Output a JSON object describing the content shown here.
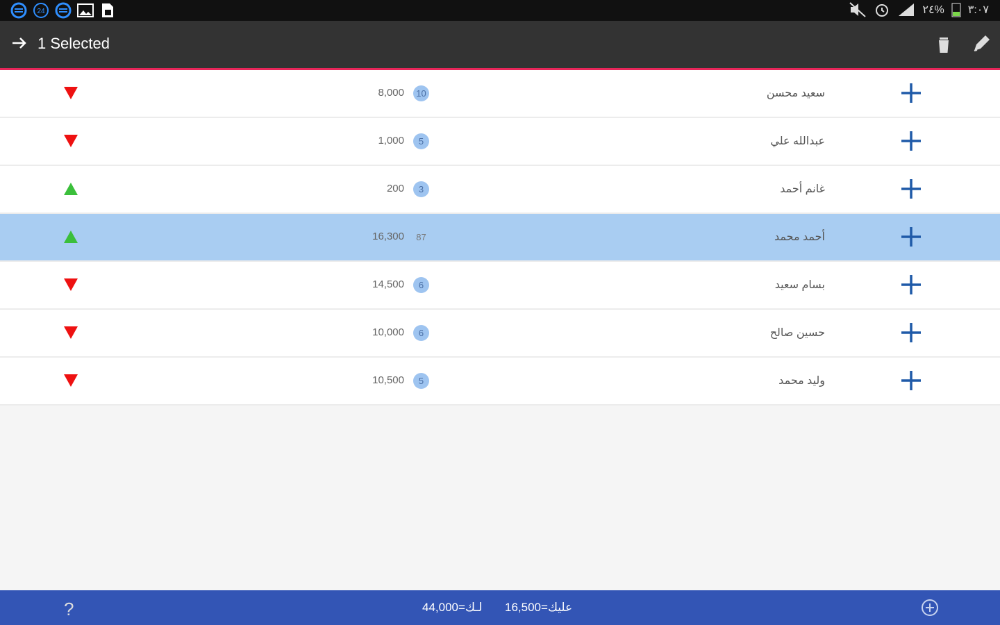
{
  "status_bar": {
    "left_icons": [
      "sync-icon",
      "calendar-icon",
      "sync-icon",
      "image-icon",
      "sim-icon"
    ],
    "calendar_label": "24",
    "right_text": "٣:٠٧",
    "battery_text": "٢٤%"
  },
  "action_bar": {
    "title": "1 Selected",
    "back_icon": "arrow-right-icon",
    "trash_icon": "trash-icon",
    "edit_icon": "pencil-icon"
  },
  "rows": [
    {
      "trend": "down",
      "amount": "8,000",
      "badge": "10",
      "name": "سعيد محسن"
    },
    {
      "trend": "down",
      "amount": "1,000",
      "badge": "5",
      "name": "عبدالله علي"
    },
    {
      "trend": "up",
      "amount": "200",
      "badge": "3",
      "name": "غانم أحمد"
    },
    {
      "trend": "up",
      "amount": "16,300",
      "badge": "87",
      "name": "أحمد محمد",
      "selected": true
    },
    {
      "trend": "down",
      "amount": "14,500",
      "badge": "6",
      "name": "بسام سعيد"
    },
    {
      "trend": "down",
      "amount": "10,000",
      "badge": "6",
      "name": "حسين صالح"
    },
    {
      "trend": "down",
      "amount": "10,500",
      "badge": "5",
      "name": "وليد محمد"
    }
  ],
  "bottom_bar": {
    "help": "?",
    "total_left": "44,000=لـك",
    "total_right": "16,500=عليك"
  },
  "colors": {
    "up": "#3bbf3b",
    "down": "#ee1111",
    "plus": "#1f5aa8",
    "selected_row": "#a9cdf2",
    "bottom_bar": "#3355b5",
    "accent_line": "#e8265a"
  }
}
